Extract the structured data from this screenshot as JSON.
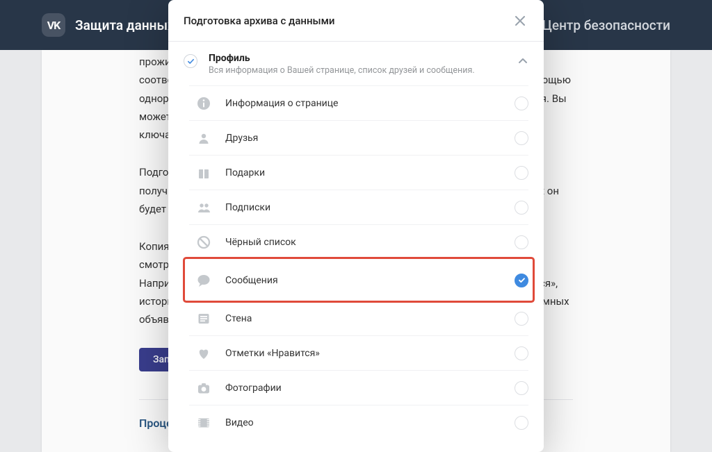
{
  "topbar": {
    "title": "Защита данных",
    "right": "Центр безопасности",
    "logo": "VK"
  },
  "page": {
    "p1": "проживания, зачем Вам это нужно и так далее, например, запросить данные в соответствии с законодательством. Повторный запрос нужно подтвердить с помощью одноразового кода. Страницу с архивом невозможно открыть из другого профиля. Вы можете защитить архив паролем или зашифровать архив с помощью публичного ключа GPG.",
    "p2": "Подготовка архива может занять от нескольких минут до нескольких дней. Вы получите уведомление, когда архив будет готов. Для безопасности Ваших данных он будет доступен только несколько дней.",
    "p3": "Копия Ваших данных предоставляется в виде ZIP-архива. Внутри данные удобнее смотреть на главной странице архива, где они разбиты на разные категории. Например, вы увидите информацию, которую ВКонтакте хранит отметку «Нравится», историю действий на странице, платежи и данные, которые при таргетинге рекламных объявлений.",
    "btn": "Запросить архив",
    "link": "Процесс обработки данных"
  },
  "modal": {
    "title": "Подготовка архива с данными",
    "section": {
      "title": "Профиль",
      "subtitle": "Вся информация о Вашей странице, список друзей и сообщения."
    },
    "options": [
      {
        "key": "page-info",
        "label": "Информация о странице",
        "checked": false,
        "highlighted": false
      },
      {
        "key": "friends",
        "label": "Друзья",
        "checked": false,
        "highlighted": false
      },
      {
        "key": "gifts",
        "label": "Подарки",
        "checked": false,
        "highlighted": false
      },
      {
        "key": "subs",
        "label": "Подписки",
        "checked": false,
        "highlighted": false
      },
      {
        "key": "blacklist",
        "label": "Чёрный список",
        "checked": false,
        "highlighted": false
      },
      {
        "key": "messages",
        "label": "Сообщения",
        "checked": true,
        "highlighted": true
      },
      {
        "key": "wall",
        "label": "Стена",
        "checked": false,
        "highlighted": false
      },
      {
        "key": "likes",
        "label": "Отметки «Нравится»",
        "checked": false,
        "highlighted": false
      },
      {
        "key": "photos",
        "label": "Фотографии",
        "checked": false,
        "highlighted": false
      },
      {
        "key": "videos",
        "label": "Видео",
        "checked": false,
        "highlighted": false
      }
    ]
  },
  "colors": {
    "accent": "#3f8ae0",
    "highlight_border": "#e04a3a",
    "topbar": "#29384a"
  }
}
